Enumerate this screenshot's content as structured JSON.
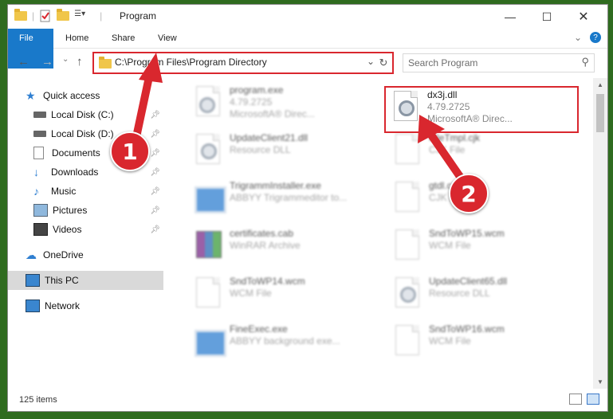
{
  "title": "Program",
  "ribbon": {
    "tabs": [
      "File",
      "Home",
      "Share",
      "View"
    ]
  },
  "address": {
    "path": "C:\\Program Files\\Program Directory"
  },
  "search": {
    "placeholder": "Search Program"
  },
  "sidebar": {
    "items": [
      {
        "label": "Quick access",
        "icon": "star-icon"
      },
      {
        "label": "Local Disk (C:)",
        "icon": "drive-icon",
        "pinned": true
      },
      {
        "label": "Local Disk (D:)",
        "icon": "drive-icon",
        "pinned": true
      },
      {
        "label": "Documents",
        "icon": "documents-icon",
        "pinned": true
      },
      {
        "label": "Downloads",
        "icon": "downloads-icon",
        "pinned": true
      },
      {
        "label": "Music",
        "icon": "music-icon",
        "pinned": true
      },
      {
        "label": "Pictures",
        "icon": "pictures-icon",
        "pinned": true
      },
      {
        "label": "Videos",
        "icon": "videos-icon",
        "pinned": true
      },
      {
        "label": "OneDrive",
        "icon": "onedrive-icon"
      },
      {
        "label": "This PC",
        "icon": "pc-icon",
        "selected": true
      },
      {
        "label": "Network",
        "icon": "network-icon"
      }
    ]
  },
  "files": [
    {
      "name": "program.exe",
      "line1": "4.79.2725",
      "line2": "MicrosoftA® Direc...",
      "icon": "exe"
    },
    {
      "name": "dx3j.dll",
      "line1": "4.79.2725",
      "line2": "MicrosoftA® Direc...",
      "icon": "dll"
    },
    {
      "name": "UpdateClient21.dll",
      "line1": "Resource DLL",
      "icon": "dll"
    },
    {
      "name": "FileTmpl.cjk",
      "line1": "CJK File",
      "icon": "doc"
    },
    {
      "name": "TrigrammInstaller.exe",
      "line1": "ABBYY Trigrammeditor to...",
      "icon": "win"
    },
    {
      "name": "gtdl.cjk",
      "line1": "CJK File",
      "icon": "doc"
    },
    {
      "name": "certificates.cab",
      "line1": "WinRAR Archive",
      "icon": "rar"
    },
    {
      "name": "SndToWP15.wcm",
      "line1": "WCM File",
      "icon": "doc"
    },
    {
      "name": "SndToWP14.wcm",
      "line1": "WCM File",
      "icon": "doc"
    },
    {
      "name": "UpdateClient65.dll",
      "line1": "Resource DLL",
      "icon": "dll"
    },
    {
      "name": "FineExec.exe",
      "line1": "ABBYY background exe...",
      "icon": "win"
    },
    {
      "name": "SndToWP16.wcm",
      "line1": "WCM File",
      "icon": "doc"
    }
  ],
  "status": {
    "count": "125 items"
  },
  "annotations": [
    "1",
    "2"
  ],
  "colors": {
    "accent": "#1979ca",
    "highlight": "#d9272e"
  }
}
